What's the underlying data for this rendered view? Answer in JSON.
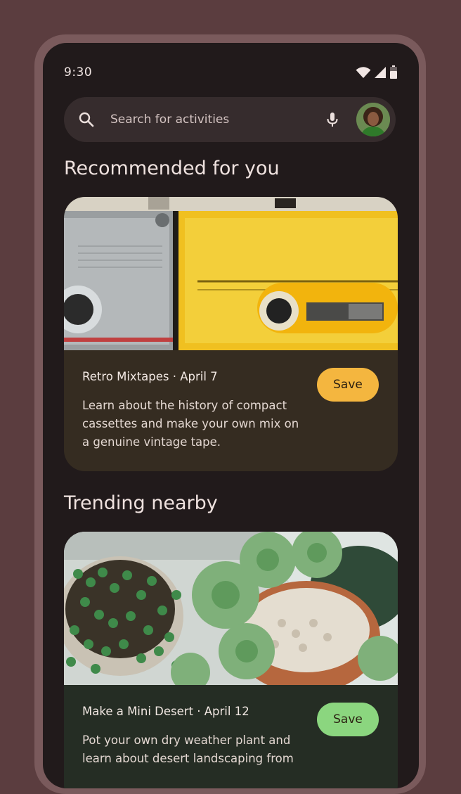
{
  "status_bar": {
    "time": "9:30"
  },
  "search": {
    "placeholder": "Search for activities"
  },
  "sections": {
    "recommended": {
      "title": "Recommended for you"
    },
    "trending": {
      "title": "Trending nearby"
    }
  },
  "cards": [
    {
      "title": "Retro Mixtapes · April 7",
      "description": "Learn about the history of compact cassettes and make your own mix on a genuine vintage tape.",
      "save_label": "Save",
      "image": "cassette-tapes-photo",
      "card_color": "#352c21",
      "button_color": "#f4b63f"
    },
    {
      "title": "Make a Mini Desert · April 12",
      "description": "Pot your own dry weather plant and learn about desert landscaping from",
      "save_label": "Save",
      "image": "potted-plants-photo",
      "card_color": "#252d24",
      "button_color": "#8bd67f"
    }
  ],
  "colors": {
    "background": "#5b3d3f",
    "screen": "#211a1b",
    "search_bar": "#362c2d"
  }
}
